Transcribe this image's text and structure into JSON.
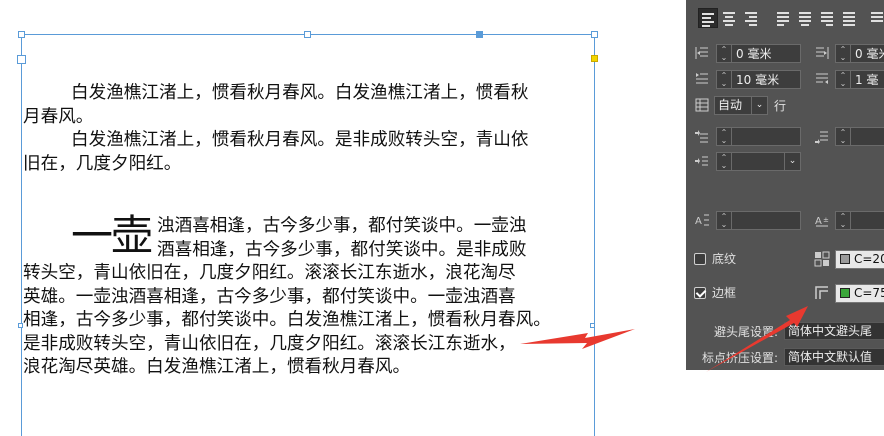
{
  "document": {
    "para1": [
      "白发渔樵江渚上，惯看秋月春风。白发渔樵江渚上，惯看秋",
      "月春风。"
    ],
    "para2": [
      "白发渔樵江渚上，惯看秋月春风。是非成败转头空，青山依",
      "旧在，几度夕阳红。"
    ],
    "dropcap": "一壶",
    "para3_dropcap_lines": [
      "浊酒喜相逢，古今多少事，都付笑谈中。一壶浊",
      "酒喜相逢，古今多少事，都付笑谈中。是非成败"
    ],
    "para3_lines": [
      "转头空，青山依旧在，几度夕阳红。滚滚长江东逝水，浪花淘尽",
      "英雄。一壶浊酒喜相逢，古今多少事，都付笑谈中。一壶浊酒喜",
      "相逢，古今多少事，都付笑谈中。白发渔樵江渚上，惯看秋月春风。",
      "是非成败转头空，青山依旧在，几度夕阳红。滚滚长江东逝水，",
      "浪花淘尽英雄。白发渔樵江渚上，惯看秋月春风。"
    ]
  },
  "panel": {
    "left_indent": "0 毫米",
    "right_indent": "0 毫米",
    "first_line_indent": "10 毫米",
    "last_line_right_indent": "1 毫",
    "auto_leading_value": "自动",
    "auto_leading_unit": "行",
    "shading_label": "底纹",
    "shading_color": "C=20",
    "border_label": "边框",
    "border_color": "C=75",
    "kinsoku_label": "避头尾设置:",
    "kinsoku_value": "简体中文避头尾",
    "mojikumi_label": "标点挤压设置:",
    "mojikumi_value": "简体中文默认值",
    "colors": {
      "panel_bg": "#535353",
      "shading_swatch": "#9a9a9a",
      "border_swatch": "#3aa63a",
      "arrow": "#e8392f",
      "frame": "#5a9bd8"
    }
  }
}
